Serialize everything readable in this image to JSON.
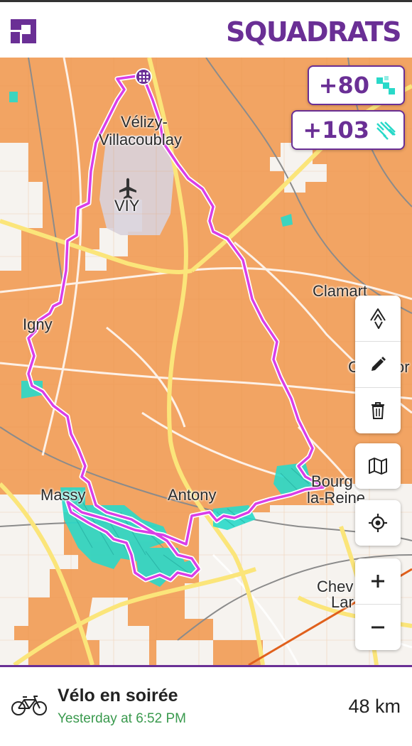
{
  "app": {
    "brand": "SQUADRATS"
  },
  "stats": {
    "squadrats_new": "+80",
    "squadratinhos_new": "+103"
  },
  "map": {
    "places": {
      "velizy_line1": "Vélizy-",
      "velizy_line2": "Villacoublay",
      "airport_code": "VIY",
      "clamart": "Clamart",
      "igny": "Igny",
      "massy": "Massy",
      "antony": "Antony",
      "bourg_line1": "Bourg",
      "bourg_line2": "la-Reine",
      "chev_line1": "Chev",
      "chev_line2": "Lar",
      "partial_c": "C",
      "partial_or": "or"
    },
    "controls": [
      "strava-icon",
      "pencil-icon",
      "trash-icon",
      "map-icon",
      "locate-icon",
      "zoom-in-icon",
      "zoom-out-icon"
    ],
    "colors": {
      "tile_fill": "#f2a463",
      "route": "#d93ee8",
      "new_tiles": "#29d9c9",
      "brand": "#6a2f95"
    }
  },
  "activity": {
    "title": "Vélo en soirée",
    "time": "Yesterday at 6:52 PM",
    "distance": "48 km",
    "icon": "bicycle-icon"
  }
}
